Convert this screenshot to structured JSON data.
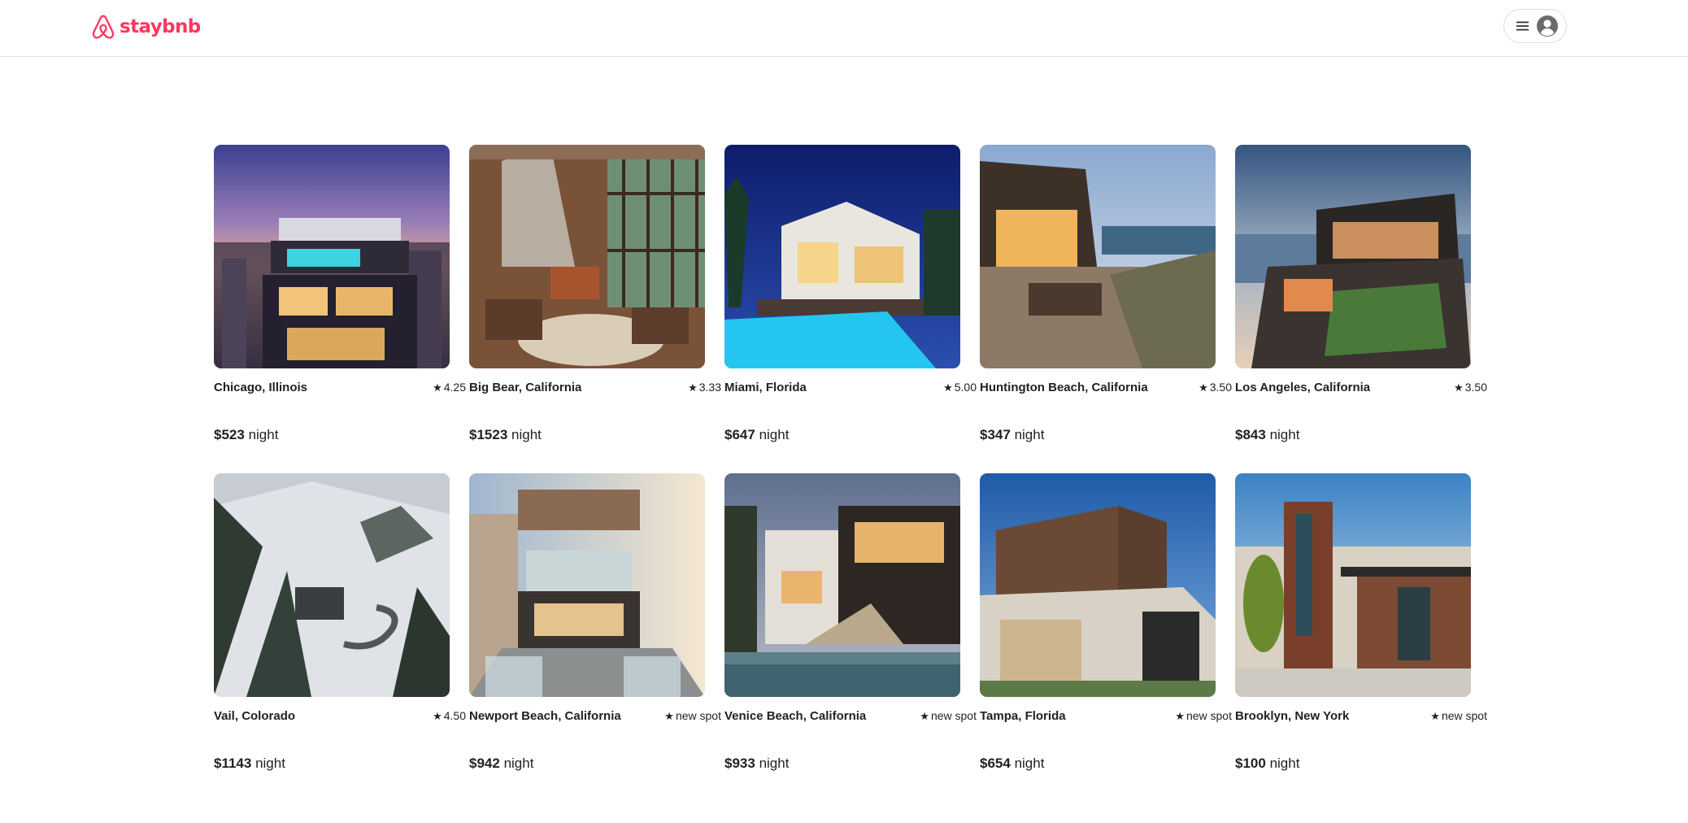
{
  "brand": {
    "name": "staybnb",
    "color": "#ff385c"
  },
  "header": {
    "menu_icon": "hamburger-icon",
    "profile_icon": "avatar-icon"
  },
  "rating_icon": "star-icon",
  "listings": [
    {
      "city": "Chicago, Illinois",
      "rating": "4.25",
      "price": "$523",
      "unit": "night"
    },
    {
      "city": "Big Bear, California",
      "rating": "3.33",
      "price": "$1523",
      "unit": "night"
    },
    {
      "city": "Miami, Florida",
      "rating": "5.00",
      "price": "$647",
      "unit": "night"
    },
    {
      "city": "Huntington Beach, California",
      "rating": "3.50",
      "price": "$347",
      "unit": "night"
    },
    {
      "city": "Los Angeles, California",
      "rating": "3.50",
      "price": "$843",
      "unit": "night"
    },
    {
      "city": "Vail, Colorado",
      "rating": "4.50",
      "price": "$1143",
      "unit": "night"
    },
    {
      "city": "Newport Beach, California",
      "rating": "new spot",
      "price": "$942",
      "unit": "night"
    },
    {
      "city": "Venice Beach, California",
      "rating": "new spot",
      "price": "$933",
      "unit": "night"
    },
    {
      "city": "Tampa, Florida",
      "rating": "new spot",
      "price": "$654",
      "unit": "night"
    },
    {
      "city": "Brooklyn, New York",
      "rating": "new spot",
      "price": "$100",
      "unit": "night"
    }
  ]
}
